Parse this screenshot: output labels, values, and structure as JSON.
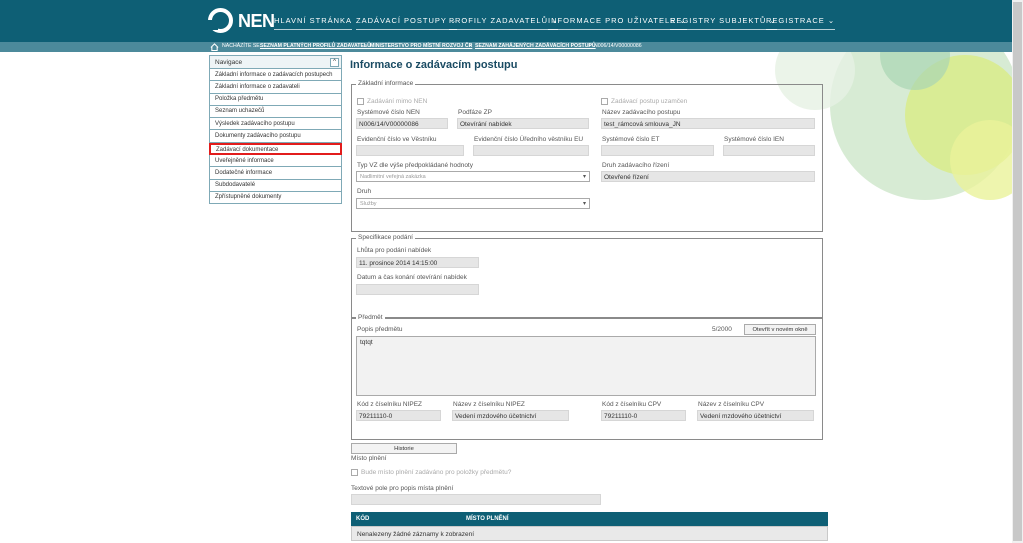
{
  "header": {
    "logo_text": "NEN",
    "nav": [
      {
        "label": "HLAVNÍ STRÁNKA"
      },
      {
        "label": "ZADÁVACÍ POSTUPY ⌄"
      },
      {
        "label": "PROFILY ZADAVATELŮ ⌄"
      },
      {
        "label": "INFORMACE PRO UŽIVATELE ⌄"
      },
      {
        "label": "REGISTRY SUBJEKTŮ ⌄"
      },
      {
        "label": "REGISTRACE ⌄"
      }
    ]
  },
  "breadcrumb": {
    "prefix": "NACHÁZÍTE SE:",
    "items": [
      "SEZNAM PLATNÝCH PROFILŮ ZADAVATELŮ",
      "MINISTERSTVO PRO MÍSTNÍ ROZVOJ ČR",
      "SEZNAM ZAHÁJENÝCH ZADÁVACÍCH POSTUPŮ",
      "N006/14/V00000086"
    ],
    "separator": ">"
  },
  "sidebar": {
    "title": "Navigace",
    "toggle": "^",
    "items": [
      {
        "label": "Základní informace o zadávacích postupech"
      },
      {
        "label": "Základní informace o zadavateli"
      },
      {
        "label": "Položka předmětu"
      },
      {
        "label": "Seznam uchazečů"
      },
      {
        "label": "Výsledek zadávacího postupu"
      },
      {
        "label": "Dokumenty zadávacího postupu"
      },
      {
        "label": "Zadávací dokumentace"
      },
      {
        "label": "Uveřejněné informace"
      },
      {
        "label": "Dodatečné informace"
      },
      {
        "label": "Subdodavatelé"
      },
      {
        "label": "Zpřístupněné dokumenty"
      }
    ]
  },
  "page_title": "Informace o zadávacím postupu",
  "basic": {
    "legend": "Základní informace",
    "zadavani_mimo_nen": "Zadávání mimo NEN",
    "postup_uzamcen": "Zadávací postup uzamčen",
    "sys_cislo_nen_label": "Systémové číslo NEN",
    "sys_cislo_nen": "N006/14/V00000086",
    "podfaze_label": "Podfáze ZP",
    "podfaze": "Otevírání nabídek",
    "nazev_label": "Název zadávacího postupu",
    "nazev": "test_rámcová smlouva_JN",
    "ev_vestnik_label": "Evidenční číslo ve Věstníku",
    "ev_eu_label": "Evidenční číslo Úředního věstníku EU",
    "sys_et_label": "Systémové číslo ET",
    "sys_ien_label": "Systémové číslo IEN",
    "typ_vz_label": "Typ VZ dle výše předpokládané hodnoty",
    "typ_vz": "Nadlimitní veřejná zakázka",
    "druh_rizeni_label": "Druh zadávacího řízení",
    "druh_rizeni": "Otevřené řízení",
    "druh_label": "Druh",
    "druh": "Služby"
  },
  "spec": {
    "legend": "Specifikace podání",
    "lhuta_label": "Lhůta pro podání nabídek",
    "lhuta": "11. prosince 2014 14:15:00",
    "otevirani_label": "Datum a čas konání otevírání nabídek"
  },
  "predmet": {
    "legend": "Předmět",
    "popis_label": "Popis předmětu",
    "counter": "5/2000",
    "open_button": "Otevřít v novém okně",
    "popis": "tqtqt",
    "nipez_kod_label": "Kód z číselníku NIPEZ",
    "nipez_kod": "79211110-0",
    "nipez_nazev_label": "Název z číselníku NIPEZ",
    "nipez_nazev": "Vedení mzdového účetnictví",
    "cpv_kod_label": "Kód z číselníku CPV",
    "cpv_kod": "79211110-0",
    "cpv_nazev_label": "Název z číselníku CPV",
    "cpv_nazev": "Vedení mzdového účetnictví"
  },
  "historie_button": "Historie",
  "misto": {
    "title": "Místo plnění",
    "checkbox_label": "Bude místo plnění zadáváno pro položky předmětu?",
    "textove_label": "Textové pole pro popis místa plnění"
  },
  "table": {
    "columns": [
      "KÓD",
      "MÍSTO PLNĚNÍ"
    ],
    "empty": "Nenalezeny žádné záznamy k zobrazení"
  },
  "colors": {
    "header": "#0e5f75",
    "breadcrumb_bar": "#4c8a9b",
    "highlight": "#e21c1c",
    "title": "#1a4b63"
  }
}
